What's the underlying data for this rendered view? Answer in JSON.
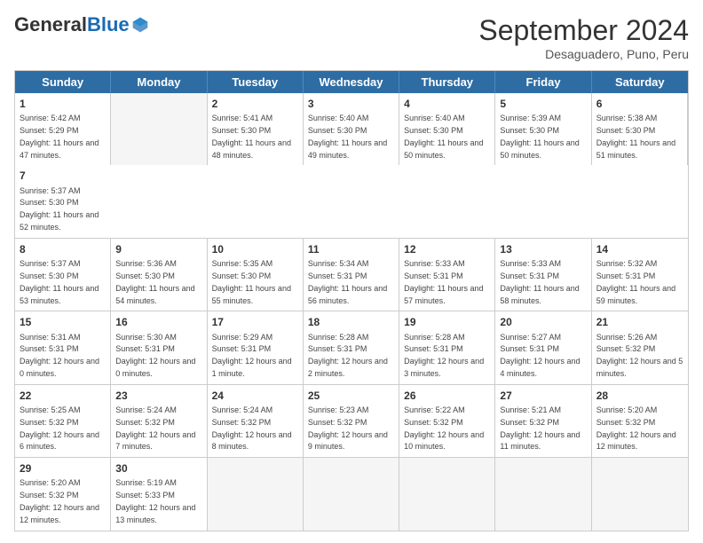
{
  "logo": {
    "general": "General",
    "blue": "Blue"
  },
  "title": "September 2024",
  "subtitle": "Desaguadero, Puno, Peru",
  "days": [
    "Sunday",
    "Monday",
    "Tuesday",
    "Wednesday",
    "Thursday",
    "Friday",
    "Saturday"
  ],
  "rows": [
    [
      {
        "day": "",
        "empty": true
      },
      {
        "day": "2",
        "sunrise": "Sunrise: 5:41 AM",
        "sunset": "Sunset: 5:30 PM",
        "daylight": "Daylight: 11 hours and 48 minutes."
      },
      {
        "day": "3",
        "sunrise": "Sunrise: 5:40 AM",
        "sunset": "Sunset: 5:30 PM",
        "daylight": "Daylight: 11 hours and 49 minutes."
      },
      {
        "day": "4",
        "sunrise": "Sunrise: 5:40 AM",
        "sunset": "Sunset: 5:30 PM",
        "daylight": "Daylight: 11 hours and 50 minutes."
      },
      {
        "day": "5",
        "sunrise": "Sunrise: 5:39 AM",
        "sunset": "Sunset: 5:30 PM",
        "daylight": "Daylight: 11 hours and 50 minutes."
      },
      {
        "day": "6",
        "sunrise": "Sunrise: 5:38 AM",
        "sunset": "Sunset: 5:30 PM",
        "daylight": "Daylight: 11 hours and 51 minutes."
      },
      {
        "day": "7",
        "sunrise": "Sunrise: 5:37 AM",
        "sunset": "Sunset: 5:30 PM",
        "daylight": "Daylight: 11 hours and 52 minutes."
      }
    ],
    [
      {
        "day": "8",
        "sunrise": "Sunrise: 5:37 AM",
        "sunset": "Sunset: 5:30 PM",
        "daylight": "Daylight: 11 hours and 53 minutes."
      },
      {
        "day": "9",
        "sunrise": "Sunrise: 5:36 AM",
        "sunset": "Sunset: 5:30 PM",
        "daylight": "Daylight: 11 hours and 54 minutes."
      },
      {
        "day": "10",
        "sunrise": "Sunrise: 5:35 AM",
        "sunset": "Sunset: 5:30 PM",
        "daylight": "Daylight: 11 hours and 55 minutes."
      },
      {
        "day": "11",
        "sunrise": "Sunrise: 5:34 AM",
        "sunset": "Sunset: 5:31 PM",
        "daylight": "Daylight: 11 hours and 56 minutes."
      },
      {
        "day": "12",
        "sunrise": "Sunrise: 5:33 AM",
        "sunset": "Sunset: 5:31 PM",
        "daylight": "Daylight: 11 hours and 57 minutes."
      },
      {
        "day": "13",
        "sunrise": "Sunrise: 5:33 AM",
        "sunset": "Sunset: 5:31 PM",
        "daylight": "Daylight: 11 hours and 58 minutes."
      },
      {
        "day": "14",
        "sunrise": "Sunrise: 5:32 AM",
        "sunset": "Sunset: 5:31 PM",
        "daylight": "Daylight: 11 hours and 59 minutes."
      }
    ],
    [
      {
        "day": "15",
        "sunrise": "Sunrise: 5:31 AM",
        "sunset": "Sunset: 5:31 PM",
        "daylight": "Daylight: 12 hours and 0 minutes."
      },
      {
        "day": "16",
        "sunrise": "Sunrise: 5:30 AM",
        "sunset": "Sunset: 5:31 PM",
        "daylight": "Daylight: 12 hours and 0 minutes."
      },
      {
        "day": "17",
        "sunrise": "Sunrise: 5:29 AM",
        "sunset": "Sunset: 5:31 PM",
        "daylight": "Daylight: 12 hours and 1 minute."
      },
      {
        "day": "18",
        "sunrise": "Sunrise: 5:28 AM",
        "sunset": "Sunset: 5:31 PM",
        "daylight": "Daylight: 12 hours and 2 minutes."
      },
      {
        "day": "19",
        "sunrise": "Sunrise: 5:28 AM",
        "sunset": "Sunset: 5:31 PM",
        "daylight": "Daylight: 12 hours and 3 minutes."
      },
      {
        "day": "20",
        "sunrise": "Sunrise: 5:27 AM",
        "sunset": "Sunset: 5:31 PM",
        "daylight": "Daylight: 12 hours and 4 minutes."
      },
      {
        "day": "21",
        "sunrise": "Sunrise: 5:26 AM",
        "sunset": "Sunset: 5:32 PM",
        "daylight": "Daylight: 12 hours and 5 minutes."
      }
    ],
    [
      {
        "day": "22",
        "sunrise": "Sunrise: 5:25 AM",
        "sunset": "Sunset: 5:32 PM",
        "daylight": "Daylight: 12 hours and 6 minutes."
      },
      {
        "day": "23",
        "sunrise": "Sunrise: 5:24 AM",
        "sunset": "Sunset: 5:32 PM",
        "daylight": "Daylight: 12 hours and 7 minutes."
      },
      {
        "day": "24",
        "sunrise": "Sunrise: 5:24 AM",
        "sunset": "Sunset: 5:32 PM",
        "daylight": "Daylight: 12 hours and 8 minutes."
      },
      {
        "day": "25",
        "sunrise": "Sunrise: 5:23 AM",
        "sunset": "Sunset: 5:32 PM",
        "daylight": "Daylight: 12 hours and 9 minutes."
      },
      {
        "day": "26",
        "sunrise": "Sunrise: 5:22 AM",
        "sunset": "Sunset: 5:32 PM",
        "daylight": "Daylight: 12 hours and 10 minutes."
      },
      {
        "day": "27",
        "sunrise": "Sunrise: 5:21 AM",
        "sunset": "Sunset: 5:32 PM",
        "daylight": "Daylight: 12 hours and 11 minutes."
      },
      {
        "day": "28",
        "sunrise": "Sunrise: 5:20 AM",
        "sunset": "Sunset: 5:32 PM",
        "daylight": "Daylight: 12 hours and 12 minutes."
      }
    ],
    [
      {
        "day": "29",
        "sunrise": "Sunrise: 5:20 AM",
        "sunset": "Sunset: 5:32 PM",
        "daylight": "Daylight: 12 hours and 12 minutes."
      },
      {
        "day": "30",
        "sunrise": "Sunrise: 5:19 AM",
        "sunset": "Sunset: 5:33 PM",
        "daylight": "Daylight: 12 hours and 13 minutes."
      },
      {
        "day": "",
        "empty": true
      },
      {
        "day": "",
        "empty": true
      },
      {
        "day": "",
        "empty": true
      },
      {
        "day": "",
        "empty": true
      },
      {
        "day": "",
        "empty": true
      }
    ]
  ],
  "row0_col0": {
    "day": "1",
    "sunrise": "Sunrise: 5:42 AM",
    "sunset": "Sunset: 5:29 PM",
    "daylight": "Daylight: 11 hours and 47 minutes."
  }
}
